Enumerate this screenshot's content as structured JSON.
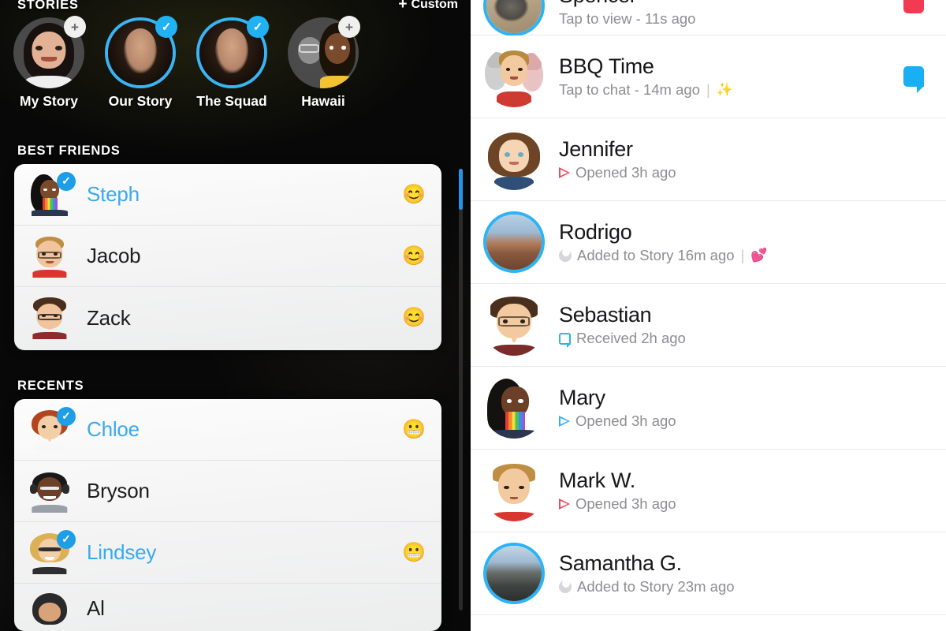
{
  "left_panel": {
    "stories_header": "STORIES",
    "custom_button": {
      "plus": "+",
      "label": "Custom"
    },
    "stories": [
      {
        "label": "My Story",
        "badge": "plus",
        "badge_glyph": "+",
        "ring": false,
        "thumb": "bitmoji-female-dark-hair"
      },
      {
        "label": "Our Story",
        "badge": "check",
        "badge_glyph": "✓",
        "ring": true,
        "thumb": "photo-selfie"
      },
      {
        "label": "The Squad",
        "badge": "check",
        "badge_glyph": "✓",
        "ring": true,
        "thumb": "photo-selfie"
      },
      {
        "label": "Hawaii",
        "badge": "plus",
        "badge_glyph": "+",
        "ring": false,
        "thumb": "bitmoji-two-friends"
      }
    ],
    "best_friends_header": "BEST FRIENDS",
    "best_friends": [
      {
        "name": "Steph",
        "selected": true,
        "emoji": "😊",
        "avatar": "bitmoji-steph"
      },
      {
        "name": "Jacob",
        "selected": false,
        "emoji": "😊",
        "avatar": "bitmoji-jacob"
      },
      {
        "name": "Zack",
        "selected": false,
        "emoji": "😊",
        "avatar": "bitmoji-zack"
      }
    ],
    "recents_header": "RECENTS",
    "recents": [
      {
        "name": "Chloe",
        "selected": true,
        "emoji": "😬",
        "avatar": "bitmoji-chloe"
      },
      {
        "name": "Bryson",
        "selected": false,
        "emoji": "",
        "avatar": "bitmoji-bryson"
      },
      {
        "name": "Lindsey",
        "selected": true,
        "emoji": "😬",
        "avatar": "bitmoji-lindsey"
      },
      {
        "name": "Al",
        "selected": false,
        "emoji": "",
        "avatar": "bitmoji-al"
      }
    ],
    "scrollbar": {
      "thumb_color": "#2196e8",
      "track_color": "#2a2a2a"
    }
  },
  "right_panel": {
    "chats": [
      {
        "name": "Spencer",
        "status_text": "Tap to view - 11s ago",
        "status_icon": "none",
        "ring": true,
        "avatar": "photo-dog",
        "right_icon": "snap-square-red",
        "extra": ""
      },
      {
        "name": "BBQ Time",
        "status_text": "Tap to chat - 14m ago",
        "status_icon": "none",
        "ring": false,
        "avatar": "bitmoji-group",
        "right_icon": "chat-bubble-blue",
        "extra": "✨"
      },
      {
        "name": "Jennifer",
        "status_text": "Opened 3h ago",
        "status_icon": "triangle-outline-red",
        "ring": false,
        "avatar": "bitmoji-jennifer",
        "right_icon": "none",
        "extra": ""
      },
      {
        "name": "Rodrigo",
        "status_text": "Added to Story 16m ago",
        "status_icon": "story-grey",
        "ring": true,
        "avatar": "photo-desert",
        "right_icon": "none",
        "extra": "💕"
      },
      {
        "name": "Sebastian",
        "status_text": "Received 2h ago",
        "status_icon": "bubble-outline-blue",
        "ring": false,
        "avatar": "bitmoji-sebastian",
        "right_icon": "none",
        "extra": ""
      },
      {
        "name": "Mary",
        "status_text": "Opened 3h ago",
        "status_icon": "triangle-outline-blue",
        "ring": false,
        "avatar": "bitmoji-mary",
        "right_icon": "none",
        "extra": ""
      },
      {
        "name": "Mark W.",
        "status_text": "Opened 3h ago",
        "status_icon": "triangle-outline-red",
        "ring": false,
        "avatar": "bitmoji-mark",
        "right_icon": "none",
        "extra": ""
      },
      {
        "name": "Samantha G.",
        "status_text": "Added to Story 23m ago",
        "status_icon": "story-grey",
        "ring": true,
        "avatar": "photo-cliff",
        "right_icon": "none",
        "extra": ""
      }
    ]
  },
  "colors": {
    "accent_blue": "#2cb3f5",
    "snap_red": "#f23b52",
    "chat_blue": "#18aff5",
    "selected_name": "#3aa9ee",
    "dark_bg": "#080808"
  }
}
